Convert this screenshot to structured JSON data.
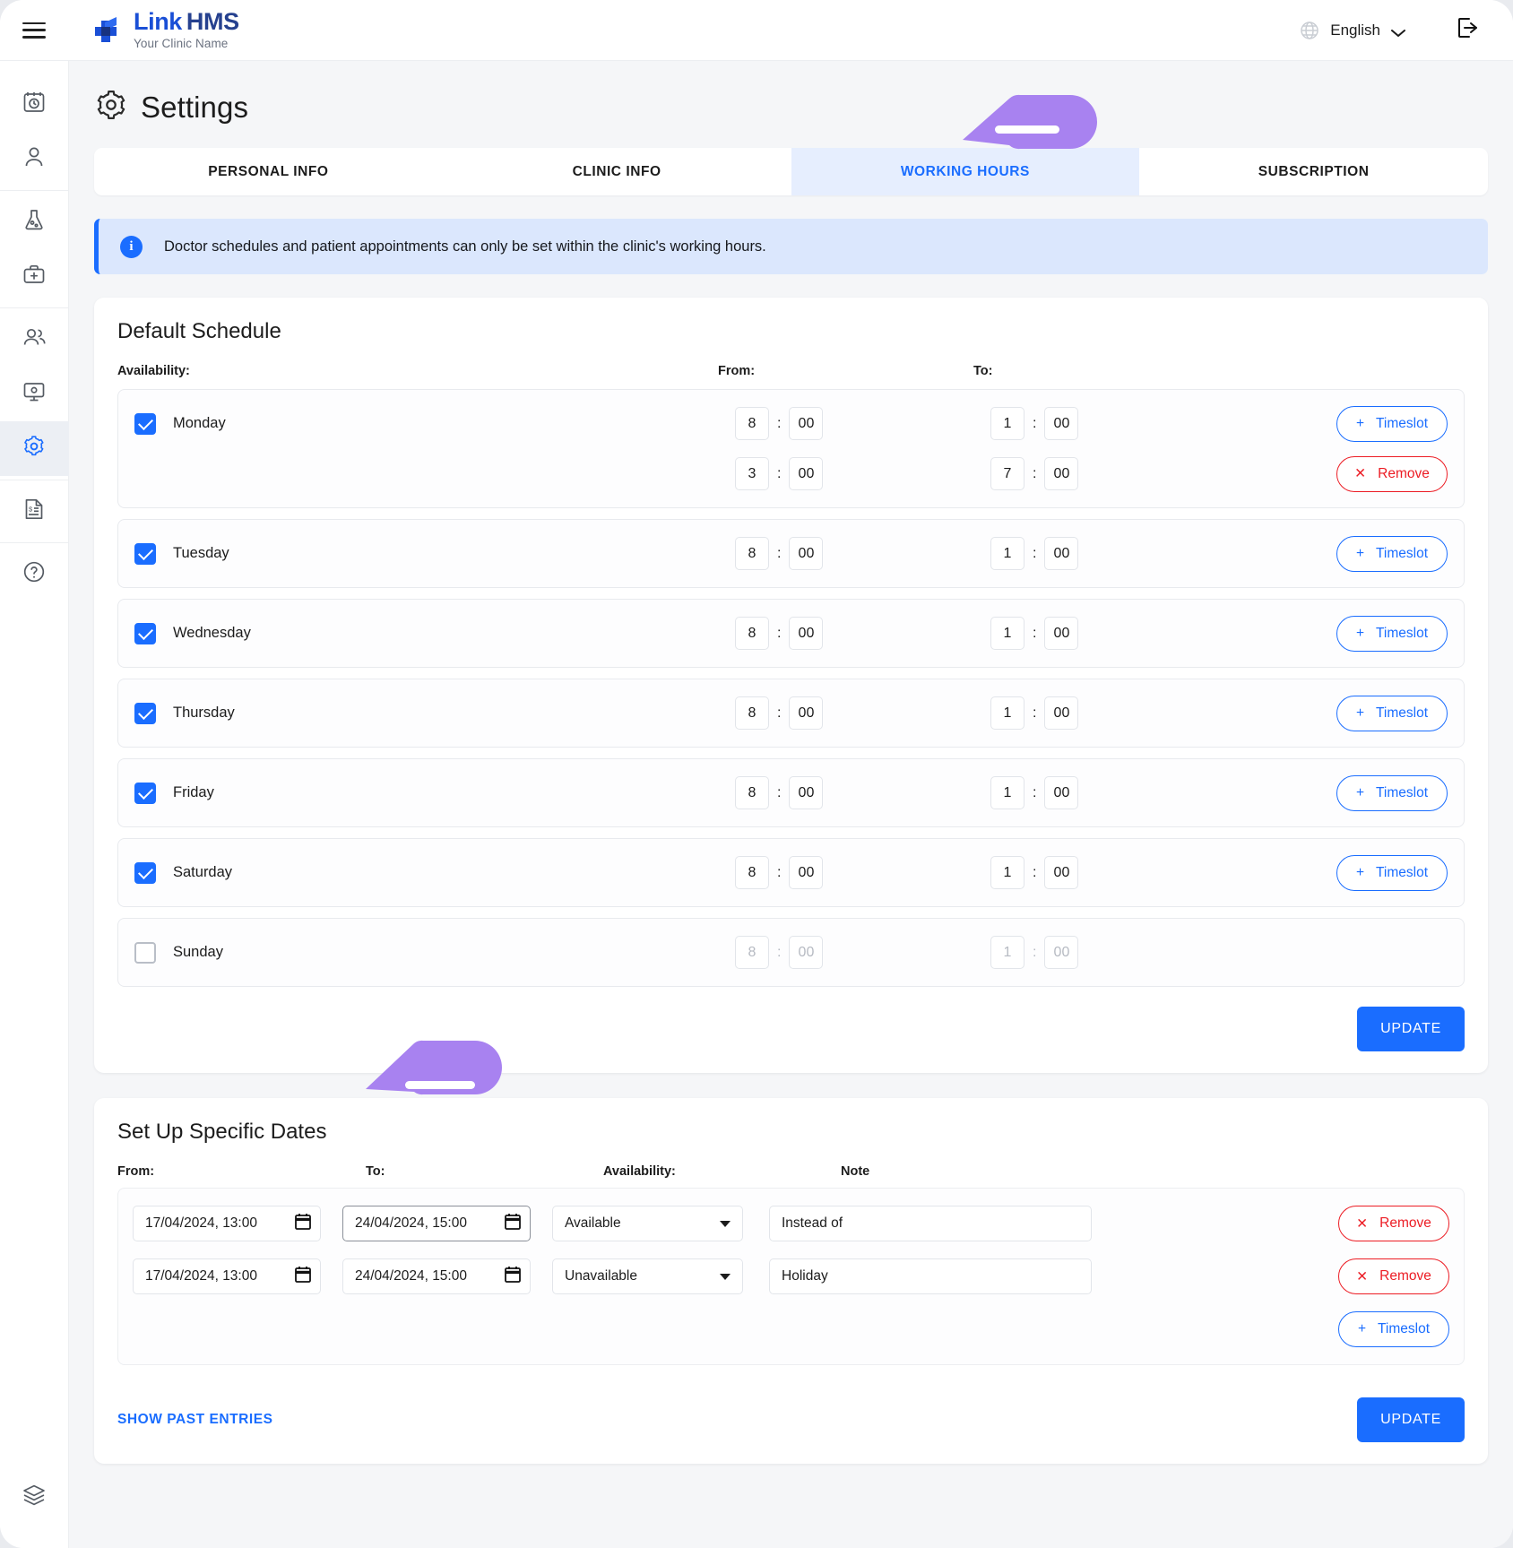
{
  "header": {
    "logo_title": "Link",
    "logo_title_2": "HMS",
    "logo_sub": "Your Clinic Name",
    "language": "English",
    "menu_icon": "hamburger-icon",
    "globe_icon": "globe-icon",
    "logout_icon": "logout-icon"
  },
  "sidebar": {
    "items": [
      {
        "icon": "appointments-calendar-icon"
      },
      {
        "icon": "patient-person-icon"
      },
      {
        "icon": "laboratory-flask-icon"
      },
      {
        "icon": "medical-bag-icon"
      },
      {
        "icon": "staff-group-icon"
      },
      {
        "icon": "monitor-settings-icon"
      },
      {
        "icon": "settings-gear-icon"
      },
      {
        "icon": "billing-invoice-icon"
      },
      {
        "icon": "help-question-icon"
      },
      {
        "icon": "database-stack-icon"
      }
    ]
  },
  "page": {
    "title": "Settings",
    "title_icon": "gear-icon"
  },
  "tabs": [
    {
      "label": "PERSONAL INFO",
      "active": false
    },
    {
      "label": "CLINIC INFO",
      "active": false
    },
    {
      "label": "WORKING HOURS",
      "active": true
    },
    {
      "label": "SUBSCRIPTION",
      "active": false
    }
  ],
  "banner": {
    "icon": "info-icon",
    "text": "Doctor schedules and patient appointments can only be set within the clinic's working hours."
  },
  "default_schedule": {
    "title": "Default Schedule",
    "columns": {
      "availability": "Availability:",
      "from": "From:",
      "to": "To:"
    },
    "days": [
      {
        "name": "Monday",
        "checked": true,
        "disabled": false,
        "slots": [
          {
            "from_h": "8",
            "from_m": "00",
            "to_h": "1",
            "to_m": "00",
            "action": "Timeslot",
            "action_type": "add"
          },
          {
            "from_h": "3",
            "from_m": "00",
            "to_h": "7",
            "to_m": "00",
            "action": "Remove",
            "action_type": "remove"
          }
        ]
      },
      {
        "name": "Tuesday",
        "checked": true,
        "disabled": false,
        "slots": [
          {
            "from_h": "8",
            "from_m": "00",
            "to_h": "1",
            "to_m": "00",
            "action": "Timeslot",
            "action_type": "add"
          }
        ]
      },
      {
        "name": "Wednesday",
        "checked": true,
        "disabled": false,
        "slots": [
          {
            "from_h": "8",
            "from_m": "00",
            "to_h": "1",
            "to_m": "00",
            "action": "Timeslot",
            "action_type": "add"
          }
        ]
      },
      {
        "name": "Thursday",
        "checked": true,
        "disabled": false,
        "slots": [
          {
            "from_h": "8",
            "from_m": "00",
            "to_h": "1",
            "to_m": "00",
            "action": "Timeslot",
            "action_type": "add"
          }
        ]
      },
      {
        "name": "Friday",
        "checked": true,
        "disabled": false,
        "slots": [
          {
            "from_h": "8",
            "from_m": "00",
            "to_h": "1",
            "to_m": "00",
            "action": "Timeslot",
            "action_type": "add"
          }
        ]
      },
      {
        "name": "Saturday",
        "checked": true,
        "disabled": false,
        "slots": [
          {
            "from_h": "8",
            "from_m": "00",
            "to_h": "1",
            "to_m": "00",
            "action": "Timeslot",
            "action_type": "add"
          }
        ]
      },
      {
        "name": "Sunday",
        "checked": false,
        "disabled": true,
        "slots": [
          {
            "from_h": "8",
            "from_m": "00",
            "to_h": "1",
            "to_m": "00",
            "action": "",
            "action_type": "none"
          }
        ]
      }
    ],
    "update_label": "UPDATE"
  },
  "specific_dates": {
    "title": "Set Up Specific Dates",
    "columns": {
      "from": "From:",
      "to": "To:",
      "availability": "Availability:",
      "note": "Note"
    },
    "rows": [
      {
        "from": "17/04/2024, 13:00",
        "to": "24/04/2024, 15:00",
        "to_focused": true,
        "availability": "Available",
        "note": "Instead of",
        "remove_label": "Remove"
      },
      {
        "from": "17/04/2024, 13:00",
        "to": "24/04/2024, 15:00",
        "to_focused": false,
        "availability": "Unavailable",
        "note": "Holiday",
        "remove_label": "Remove"
      }
    ],
    "add_timeslot_label": "Timeslot",
    "show_past_label": "SHOW PAST ENTRIES",
    "update_label": "UPDATE"
  },
  "annotations": {
    "arrow_color": "#a882f0",
    "arrows": [
      {
        "name": "arrow-pointing-working-hours-tab"
      },
      {
        "name": "arrow-pointing-set-up-specific-dates"
      }
    ]
  },
  "colors": {
    "accent": "#1a6dff",
    "danger": "#ec1c24",
    "tab_active_bg": "#e6eefe",
    "banner_bg": "#dbe7fd",
    "page_bg": "#f5f6f8"
  }
}
